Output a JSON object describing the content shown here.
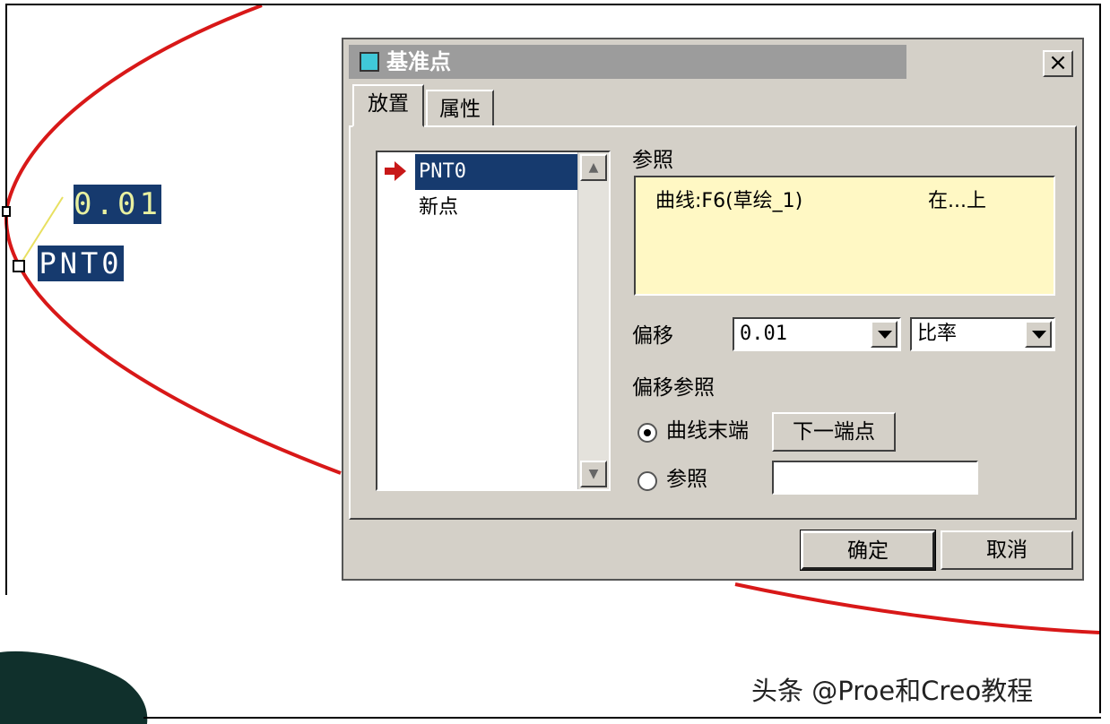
{
  "viewport": {
    "dimension_value": "0.01",
    "point_label": "PNT0",
    "curve_color": "#d81818"
  },
  "dialog": {
    "title": "基准点",
    "close_glyph": "×",
    "tabs": [
      {
        "label": "放置",
        "active": true
      },
      {
        "label": "属性",
        "active": false
      }
    ],
    "point_list": [
      {
        "label": "PNT0",
        "selected": true
      },
      {
        "label": "新点",
        "selected": false
      }
    ],
    "references": {
      "label": "参照",
      "items": [
        {
          "entity": "曲线:F6(草绘_1)",
          "type": "在...上"
        }
      ]
    },
    "offset": {
      "label": "偏移",
      "value": "0.01",
      "mode": "比率"
    },
    "offset_reference": {
      "label": "偏移参照",
      "options": [
        {
          "label": "曲线末端",
          "selected": true
        },
        {
          "label": "参照",
          "selected": false
        }
      ],
      "next_endpoint_label": "下一端点",
      "reference_value": ""
    },
    "buttons": {
      "ok": "确定",
      "cancel": "取消"
    }
  },
  "watermark": "头条 @Proe和Creo教程",
  "colors": {
    "selection": "#163a6e",
    "dialog_bg": "#d4d0c8",
    "reference_box": "#fff8c4",
    "title_icon": "#40c8d8",
    "arrow": "#c81818"
  },
  "icons": {
    "title": "datum-point-icon",
    "list_pointer": "red-arrow-icon",
    "scroll_up": "scroll-up-arrow-icon",
    "scroll_down": "scroll-down-arrow-icon",
    "combo": "dropdown-arrow-icon"
  }
}
